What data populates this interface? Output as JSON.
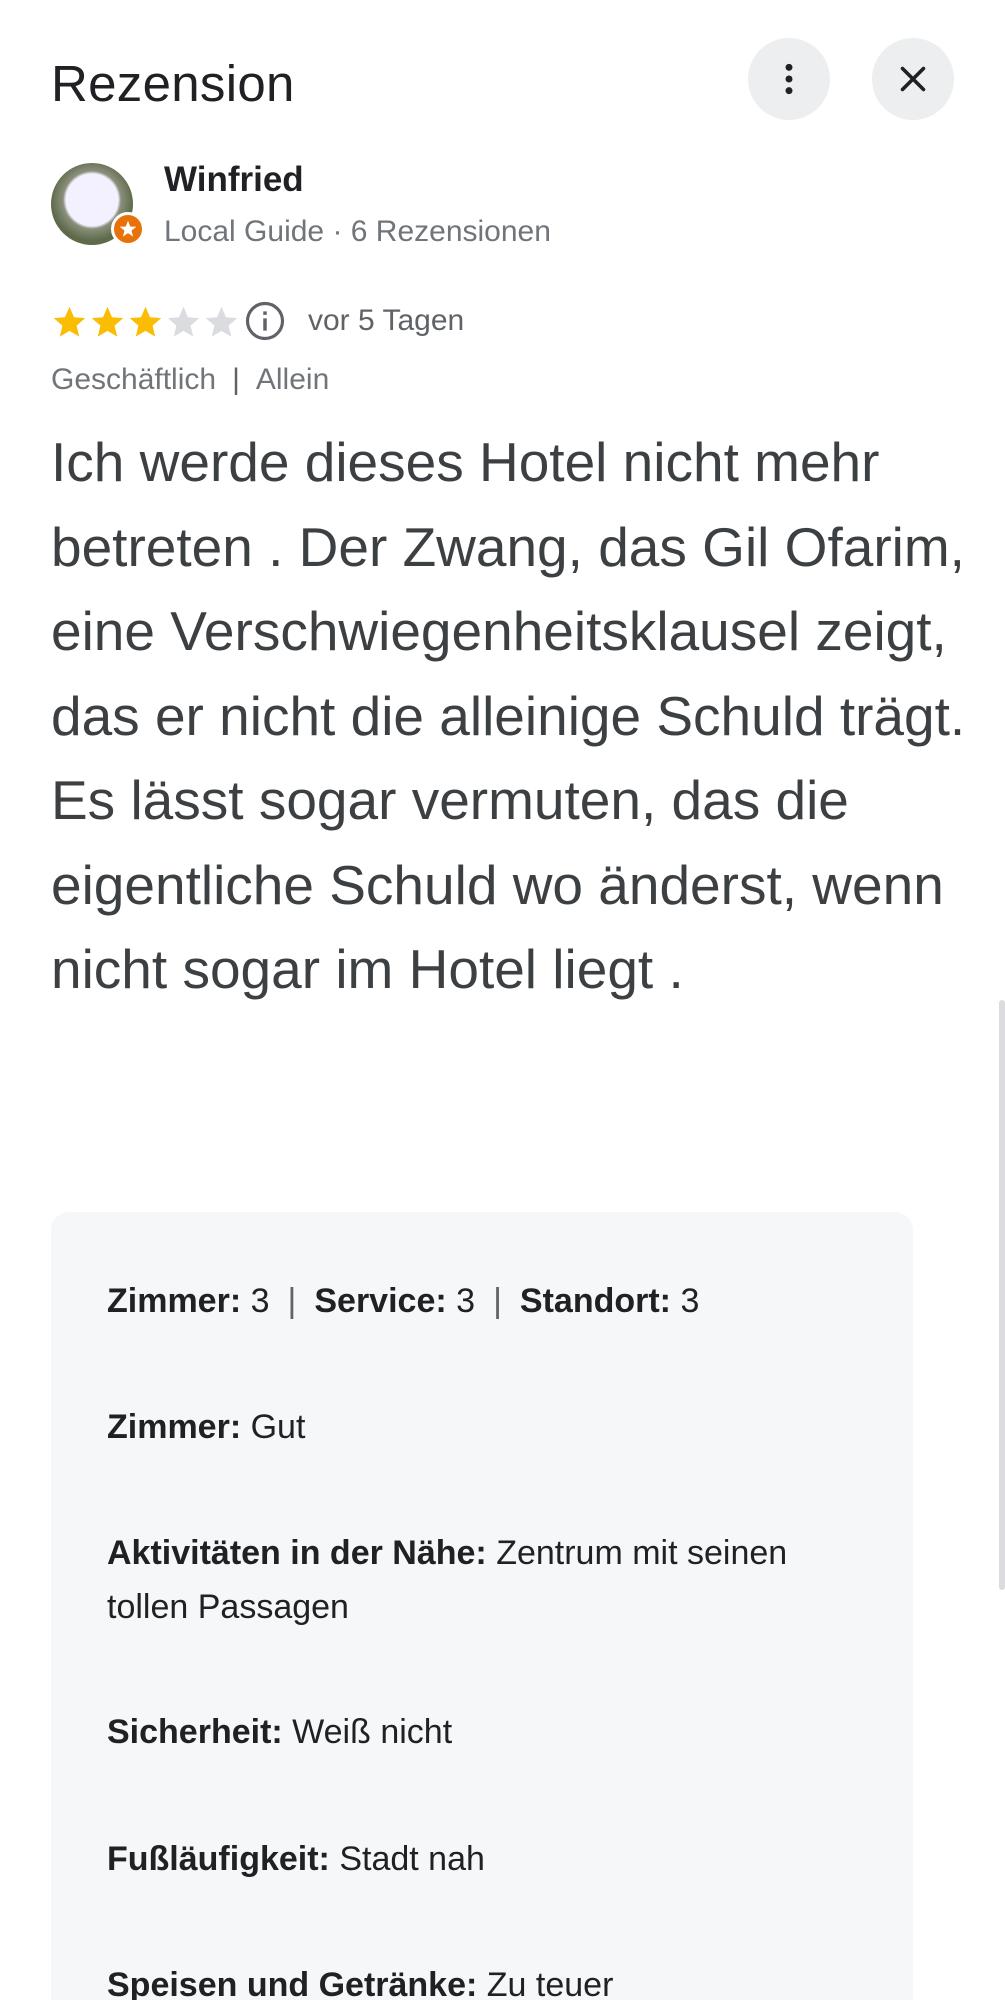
{
  "header": {
    "title": "Rezension",
    "more_icon": "more-vert-icon",
    "close_icon": "close-icon"
  },
  "author": {
    "name": "Winfried",
    "meta": "Local Guide · 6 Rezensionen",
    "badge_icon": "local-guide-star-icon"
  },
  "rating": {
    "stars_filled": 3,
    "stars_total": 5,
    "star_color": "#fbbc04",
    "star_empty_color": "#dadce0",
    "info_icon": "info-icon",
    "date": "vor 5 Tagen"
  },
  "tags": {
    "trip_type": "Geschäftlich",
    "separator": "|",
    "travel_group": "Allein"
  },
  "review_text": "Ich werde dieses Hotel nicht mehr betreten . Der Zwang, das Gil Ofarim, eine Verschwiegenheitsklausel zeigt, das er nicht die alleinige Schuld trägt. Es lässt sogar vermuten, das die eigentliche Schuld wo änderst, wenn nicht sogar im Hotel liegt .",
  "card": {
    "scores": [
      {
        "label": "Zimmer:",
        "value": "3"
      },
      {
        "label": "Service:",
        "value": "3"
      },
      {
        "label": "Standort:",
        "value": "3"
      }
    ],
    "score_separator": "|",
    "attributes": [
      {
        "label": "Zimmer:",
        "value": "Gut"
      },
      {
        "label": "Aktivitäten in der Nähe:",
        "value": "Zentrum mit seinen tollen Passagen"
      },
      {
        "label": "Sicherheit:",
        "value": "Weiß nicht"
      },
      {
        "label": "Fußläufigkeit:",
        "value": "Stadt nah"
      },
      {
        "label": "Speisen und Getränke:",
        "value": "Zu teuer"
      }
    ]
  },
  "colors": {
    "accent_orange": "#e8710a",
    "button_bg": "#eceef0",
    "card_bg": "#f6f7f9"
  }
}
